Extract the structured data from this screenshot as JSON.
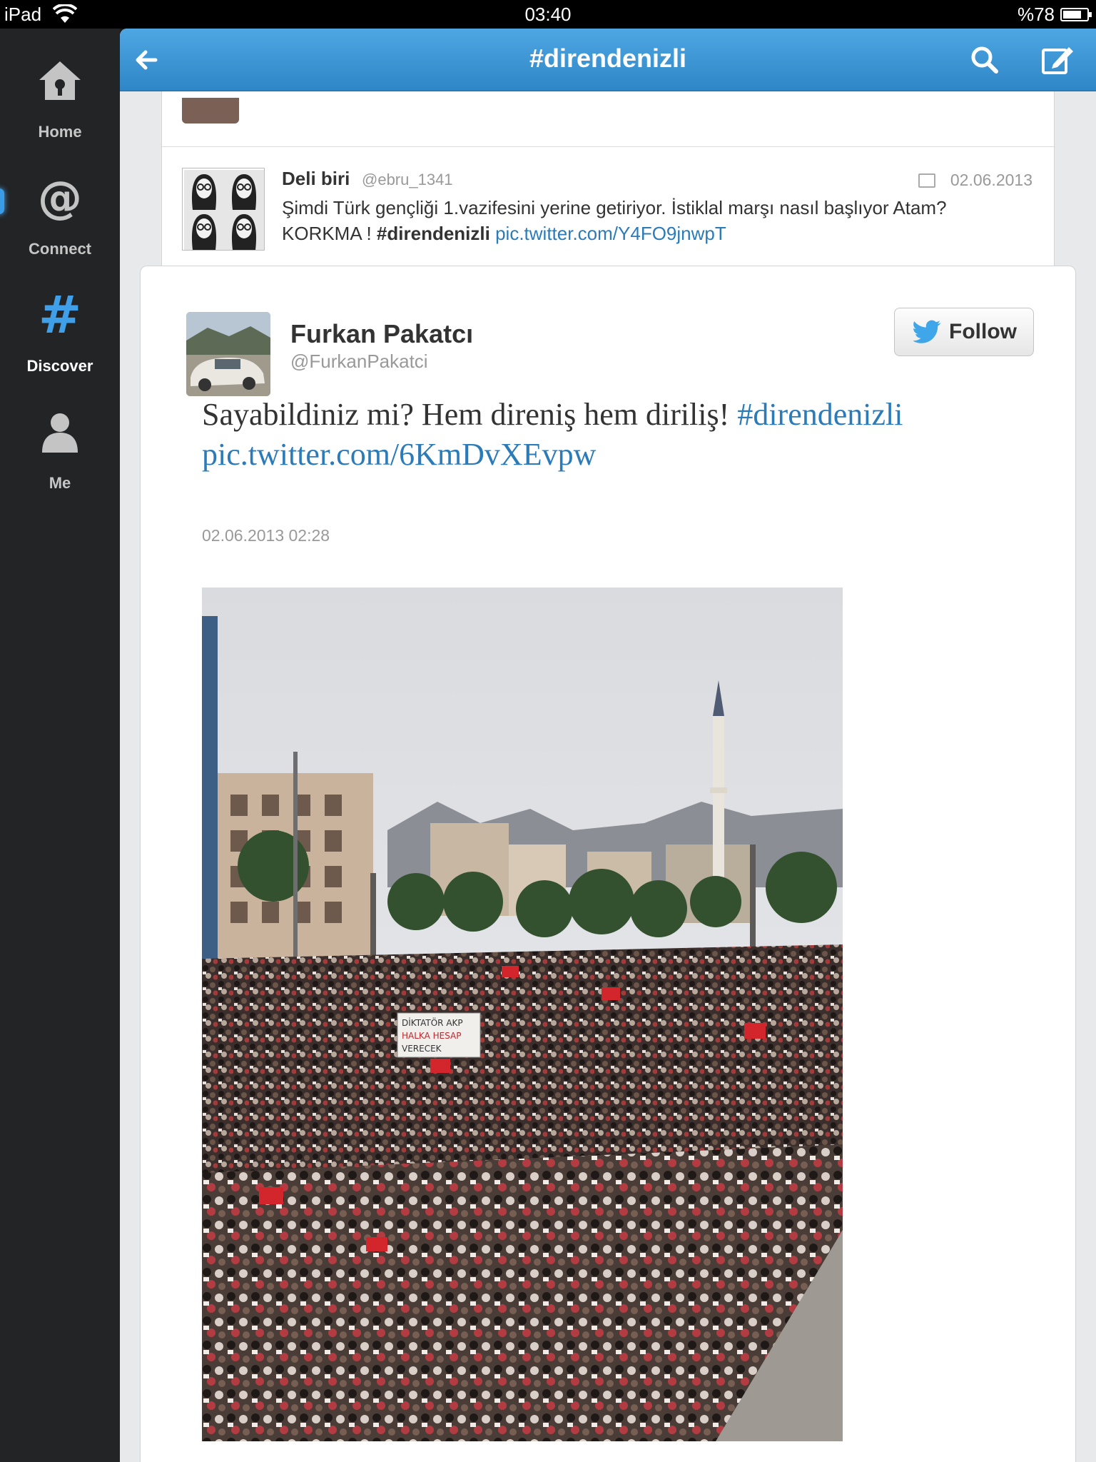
{
  "status_bar": {
    "device": "iPad",
    "time": "03:40",
    "battery": "%78",
    "battery_level": 0.78
  },
  "sidebar": {
    "items": [
      {
        "label": "Home",
        "icon": "home-icon",
        "active": false
      },
      {
        "label": "Connect",
        "icon": "at-icon",
        "active": false
      },
      {
        "label": "Discover",
        "icon": "hashtag-icon",
        "active": true
      },
      {
        "label": "Me",
        "icon": "person-icon",
        "active": false
      }
    ]
  },
  "navbar": {
    "title": "#direndenizli",
    "back_icon": "back-arrow-icon",
    "search_icon": "search-icon",
    "compose_icon": "compose-icon"
  },
  "previous_tweet": {
    "name": "Deli biri",
    "handle": "@ebru_1341",
    "date": "02.06.2013",
    "text_1": "Şimdi Türk gençliği 1.vazifesini yerine getiriyor. İstiklal marşı nasıl başlıyor Atam? KORKMA ! ",
    "hashtag": "#direndenizli",
    "link": "pic.twitter.com/Y4FO9jnwpT"
  },
  "tweet": {
    "name": "Furkan Pakatcı",
    "handle": "@FurkanPakatci",
    "follow_label": "Follow",
    "text_1": "Sayabildiniz mi? Hem direniş hem diriliş! ",
    "hashtag": "#direndenizli",
    "link": "pic.twitter.com/6KmDvXEvpw",
    "timestamp": "02.06.2013 02:28",
    "photo_banner_1": "DİKTATÖR AKP",
    "photo_banner_2": "HALKA HESAP",
    "photo_banner_3": "VERECEK"
  },
  "colors": {
    "navbar_top": "#4ea6e2",
    "navbar_bottom": "#2e86c7",
    "link": "#2b7bb9",
    "sidebar_bg": "#222426",
    "discover_accent": "#3f9fe8"
  }
}
